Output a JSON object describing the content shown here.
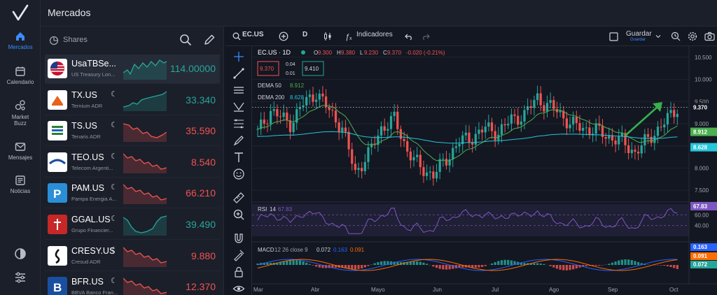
{
  "header": {
    "title": "Mercados"
  },
  "nav": {
    "items": [
      {
        "label": "Mercados",
        "icon": "home-icon",
        "active": true
      },
      {
        "label": "Calendario",
        "icon": "calendar-icon"
      },
      {
        "label": "Market",
        "label2": "Buzz",
        "icon": "market-buzz-icon"
      },
      {
        "label": "Mensajes",
        "icon": "mail-icon"
      },
      {
        "label": "Noticias",
        "icon": "news-icon"
      }
    ]
  },
  "watchlist": {
    "title": "Shares",
    "rows": [
      {
        "symbol": "UsaTBSe...",
        "name": "US Treasury Lon...",
        "price": "114.00000",
        "trend": "up",
        "moon": false
      },
      {
        "symbol": "TX.US",
        "name": "Ternium ADR",
        "price": "33.340",
        "trend": "up",
        "moon": true
      },
      {
        "symbol": "TS.US",
        "name": "Tenaris ADR",
        "price": "35.590",
        "trend": "down",
        "moon": true
      },
      {
        "symbol": "TEO.US",
        "name": "Telecom Argenti...",
        "price": "8.540",
        "trend": "down",
        "moon": true
      },
      {
        "symbol": "PAM.US",
        "name": "Pampa Energia A...",
        "price": "66.210",
        "trend": "down",
        "moon": true
      },
      {
        "symbol": "GGAL.US",
        "name": "Grupo Financier...",
        "price": "39.490",
        "trend": "up",
        "moon": true
      },
      {
        "symbol": "CRESY.US",
        "name": "Cresud ADR",
        "price": "9.880",
        "trend": "down",
        "moon": true
      },
      {
        "symbol": "BFR.US",
        "name": "BBVA Banco Fran...",
        "price": "12.370",
        "trend": "down",
        "moon": true
      }
    ]
  },
  "toolbar": {
    "symbol": "EC.US",
    "interval": "D",
    "indicators": "Indicadores",
    "save": "Guardar",
    "save_sub": "Guardar"
  },
  "chart": {
    "legend_symbol": "EC.US · 1D",
    "o_label": "O",
    "o": "9.300",
    "h_label": "H",
    "h": "9.380",
    "l_label": "L",
    "l": "9.230",
    "c_label": "C",
    "c": "9.370",
    "change": "-0.020 (-0.21%)",
    "sell_price": "9.370",
    "spread_top": "0.04",
    "spread_bottom": "0.01",
    "buy_price": "9.410",
    "dema50_label": "DEMA 50",
    "dema50": "8.912",
    "dema200_label": "DEMA 200",
    "dema200": "8.628",
    "rsi_label": "RSI",
    "rsi_period": "14",
    "rsi_value": "67.83",
    "macd_label": "MACD",
    "macd_params": "12 26 close 9",
    "macd_v1": "0.072",
    "macd_v2": "0.163",
    "macd_v3": "0.091",
    "price_axis": [
      "10.500",
      "10.000",
      "9.500",
      "9.000",
      "8.500",
      "8.000",
      "7.500"
    ],
    "badges": {
      "last": "9.370",
      "dema50": "8.912",
      "dema200": "8.628",
      "rsi": "67.83",
      "macd_a": "0.163",
      "macd_b": "0.091",
      "macd_c": "0.072"
    },
    "rsi_axis": [
      "60.00",
      "40.00"
    ],
    "time_axis": [
      "Mar",
      "Abr",
      "Mayo",
      "Jun",
      "Jul",
      "Ago",
      "Sep",
      "Oct"
    ],
    "colors": {
      "up": "#26a69a",
      "down": "#ef5350",
      "dema50": "#4caf50",
      "dema200": "#26c6da",
      "rsi": "#7e57c2",
      "accent": "#3a8cff"
    }
  }
}
